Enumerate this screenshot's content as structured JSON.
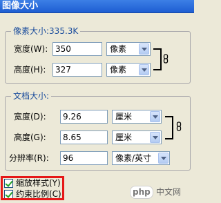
{
  "window": {
    "title": "图像大小"
  },
  "pixel_group": {
    "legend": "像素大小:335.3K",
    "rows": [
      {
        "label": "宽度(W):",
        "value": "350",
        "unit": "像素"
      },
      {
        "label": "高度(H):",
        "value": "327",
        "unit": "像素"
      }
    ]
  },
  "doc_group": {
    "legend": "文档大小:",
    "rows": [
      {
        "label": "宽度(D):",
        "value": "9.26",
        "unit": "厘米"
      },
      {
        "label": "高度(G):",
        "value": "8.65",
        "unit": "厘米"
      },
      {
        "label": "分辨率(R):",
        "value": "96",
        "unit": "像素/英寸"
      }
    ]
  },
  "options": [
    {
      "label": "缩放样式(Y)",
      "checked": true
    },
    {
      "label": "约束比例(C)",
      "checked": true
    }
  ],
  "watermark": {
    "logo": "php",
    "text": "中文网"
  },
  "colors": {
    "title_bar": "#1e5ed2",
    "highlight_box": "#e51818",
    "legend_text": "#1a4c9c"
  }
}
